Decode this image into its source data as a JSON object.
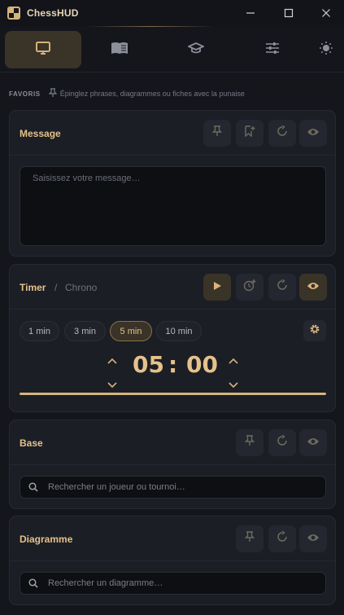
{
  "window": {
    "title": "ChessHUD",
    "controls": [
      "minimize",
      "maximize",
      "close"
    ]
  },
  "nav": {
    "tabs": [
      {
        "icon": "monitor-icon",
        "active": true
      },
      {
        "icon": "book-icon",
        "active": false
      },
      {
        "icon": "graduation-cap-icon",
        "active": false
      },
      {
        "icon": "sliders-icon",
        "active": false
      }
    ],
    "theme_icon": "sun-icon"
  },
  "favorites": {
    "label": "FAVORIS",
    "hint": "Épinglez phrases, diagrammes ou fiches avec la punaise"
  },
  "message": {
    "title": "Message",
    "placeholder": "Saisissez votre message…",
    "value": ""
  },
  "timer": {
    "title": "Timer",
    "separator": "/",
    "subtitle": "Chrono",
    "presets": [
      "1 min",
      "3 min",
      "5 min",
      "10 min"
    ],
    "selected_preset": "5 min",
    "minutes": "05",
    "colon": ":",
    "seconds": "00",
    "progress": 1.0
  },
  "base": {
    "title": "Base",
    "search_placeholder": "Rechercher un joueur ou tournoi…"
  },
  "diagram": {
    "title": "Diagramme",
    "search_placeholder": "Rechercher un diagramme…"
  },
  "colors": {
    "accent": "#d4b27a",
    "background": "#14161c",
    "card": "#1b1e25",
    "input": "#0d0f13"
  }
}
